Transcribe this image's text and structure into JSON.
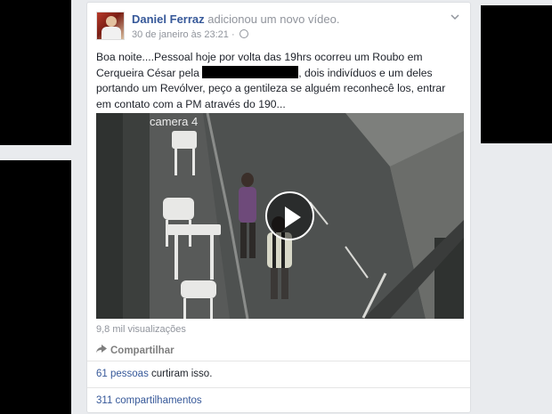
{
  "post": {
    "author": "Daniel Ferraz",
    "action": "adicionou um novo vídeo.",
    "timestamp": "30 de janeiro às 23:21",
    "text_before_redaction": "Boa noite....Pessoal hoje por volta das 19hrs ocorreu um Roubo em Cerqueira César pela",
    "text_after_redaction": ", dois indivíduos e um deles portando um Revólver, peço a gentileza se alguém reconhecê los, entrar em contato com a PM através do 190...",
    "video_overlay_text": "camera 4",
    "views": "9,8 mil visualizações",
    "share_label": "Compartilhar",
    "likes_count": "61 pessoas",
    "likes_suffix": "curtiram isso.",
    "shares_count": "311 compartilhamentos"
  },
  "icons": {
    "menu": "chevron-down-icon",
    "privacy": "globe-icon",
    "video_control": "play-icon",
    "share": "share-arrow-icon"
  },
  "colors": {
    "link": "#365899",
    "muted": "#90949c",
    "page_background": "#e9ebee"
  }
}
